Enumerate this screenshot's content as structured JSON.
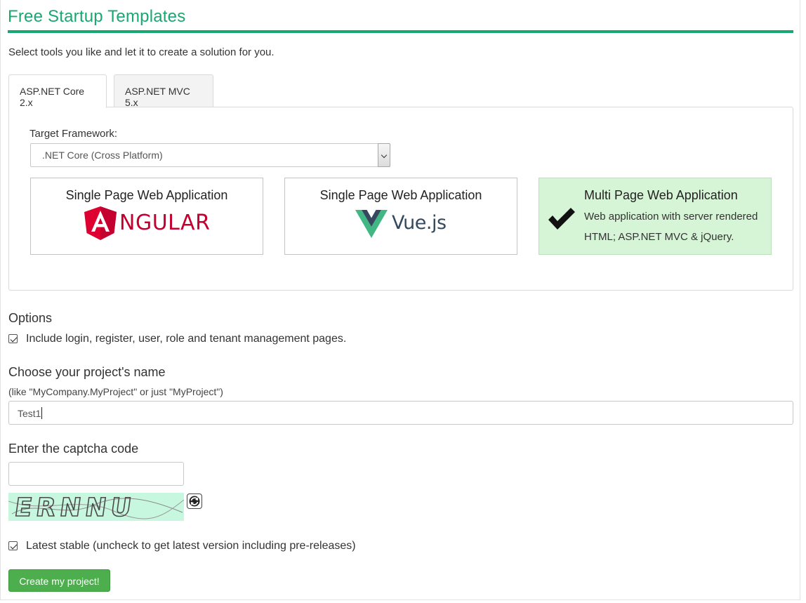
{
  "header": {
    "title": "Free Startup Templates",
    "intro": "Select tools you like and let it to create a solution for you."
  },
  "tabs": [
    {
      "label": "ASP.NET Core 2.x",
      "active": true
    },
    {
      "label": "ASP.NET MVC 5.x",
      "active": false
    }
  ],
  "framework": {
    "label": "Target Framework:",
    "selected": ".NET Core (Cross Platform)"
  },
  "cards": [
    {
      "title": "Single Page Web Application",
      "logo_text": "NGULAR",
      "logo_icon": "angular-logo",
      "selected": false
    },
    {
      "title": "Single Page Web Application",
      "logo_text": "Vue.js",
      "logo_icon": "vue-logo",
      "selected": false
    },
    {
      "title": "Multi Page Web Application",
      "description": "Web application with server rendered HTML; ASP.NET MVC & jQuery.",
      "selected": true,
      "selected_color": "#d6f5d6"
    }
  ],
  "options": {
    "heading": "Options",
    "include_login_label": "Include login, register, user, role and tenant management pages.",
    "include_login_checked": true
  },
  "project_name": {
    "heading": "Choose your project's name",
    "hint": "(like \"MyCompany.MyProject\" or just \"MyProject\")",
    "value": "Test1"
  },
  "captcha": {
    "heading": "Enter the captcha code",
    "value": "",
    "image_text": "ERNNU"
  },
  "latest_stable": {
    "label": "Latest stable (uncheck to get latest version including pre-releases)",
    "checked": true
  },
  "create_button": {
    "label": "Create my project!"
  },
  "colors": {
    "brand": "#1aa872",
    "button": "#4cae4c",
    "angular": "#c3002f",
    "vue_green": "#41b883",
    "vue_dark": "#35495e"
  }
}
